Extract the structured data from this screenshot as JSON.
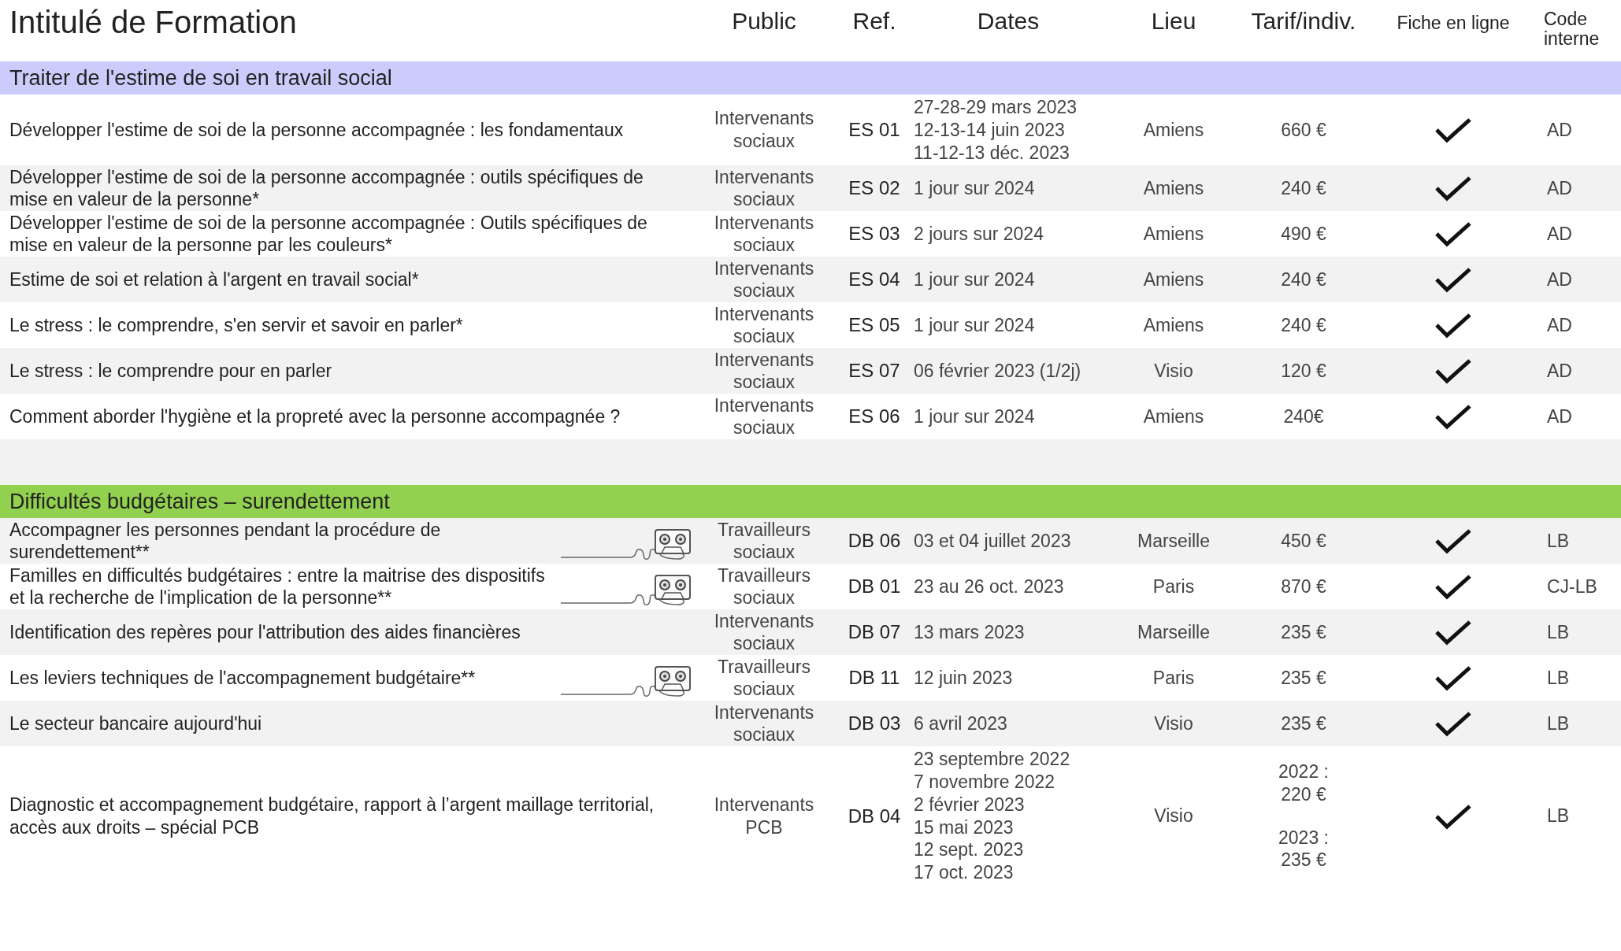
{
  "columns": [
    "Intitulé de Formation",
    "Public",
    "Ref.",
    "Dates",
    "Lieu",
    "Tarif/indiv.",
    "Fiche en ligne",
    "Code interne"
  ],
  "sections": [
    {
      "title": "Traiter de l'estime de soi en travail social",
      "color": "#ccccfc",
      "rows": [
        {
          "title": "Développer l'estime de soi de la personne accompagnée : les fondamentaux",
          "audio": false,
          "public": "Intervenants sociaux",
          "ref": "ES 01",
          "dates": [
            "27-28-29 mars 2023",
            "12-13-14 juin 2023",
            "11-12-13 déc. 2023"
          ],
          "lieu": "Amiens",
          "tarif": [
            "660 €"
          ],
          "online": true,
          "code": "AD",
          "shaded": false
        },
        {
          "title": "Développer l'estime de soi de la personne accompagnée : outils spécifiques de mise en valeur de la personne*",
          "audio": false,
          "public": "Intervenants sociaux",
          "ref": "ES 02",
          "dates": [
            "1 jour sur 2024"
          ],
          "lieu": "Amiens",
          "tarif": [
            "240 €"
          ],
          "online": true,
          "code": "AD",
          "shaded": true
        },
        {
          "title": "Développer l'estime de soi de la personne accompagnée : Outils spécifiques de mise en valeur de la personne par les couleurs*",
          "audio": false,
          "public": "Intervenants sociaux",
          "ref": "ES 03",
          "dates": [
            "2 jours sur 2024"
          ],
          "lieu": "Amiens",
          "tarif": [
            "490 €"
          ],
          "online": true,
          "code": "AD",
          "shaded": false
        },
        {
          "title": "Estime de soi et relation à l'argent en travail social*",
          "audio": false,
          "public": "Intervenants sociaux",
          "ref": "ES 04",
          "dates": [
            "1 jour sur 2024"
          ],
          "lieu": "Amiens",
          "tarif": [
            "240 €"
          ],
          "online": true,
          "code": "AD",
          "shaded": true
        },
        {
          "title": "Le stress : le comprendre, s'en servir et savoir en parler*",
          "audio": false,
          "public": "Intervenants sociaux",
          "ref": "ES 05",
          "dates": [
            "1 jour sur 2024"
          ],
          "lieu": "Amiens",
          "tarif": [
            "240 €"
          ],
          "online": true,
          "code": "AD",
          "shaded": false
        },
        {
          "title": "Le stress : le comprendre pour en parler",
          "audio": false,
          "public": "Intervenants sociaux",
          "ref": "ES 07",
          "dates": [
            "06 février 2023 (1/2j)"
          ],
          "lieu": "Visio",
          "tarif": [
            "120 €"
          ],
          "online": true,
          "code": "AD",
          "shaded": true
        },
        {
          "title": "Comment aborder l'hygiène et la propreté avec la personne accompagnée ?",
          "audio": false,
          "public": "Intervenants sociaux",
          "ref": "ES 06",
          "dates": [
            "1 jour sur 2024"
          ],
          "lieu": "Amiens",
          "tarif": [
            "240€"
          ],
          "online": true,
          "code": "AD",
          "shaded": false
        }
      ]
    },
    {
      "title": "Difficultés budgétaires – surendettement",
      "color": "#92d050",
      "rows": [
        {
          "title": "Accompagner les personnes pendant la procédure de surendettement**",
          "audio": true,
          "public": "Travailleurs sociaux",
          "ref": "DB 06",
          "dates": [
            "03 et 04 juillet 2023"
          ],
          "lieu": "Marseille",
          "tarif": [
            "450 €"
          ],
          "online": true,
          "code": "LB",
          "shaded": true
        },
        {
          "title": "Familles en difficultés budgétaires : entre la maitrise des dispositifs et la recherche de l'implication de la personne**",
          "audio": true,
          "public": "Travailleurs sociaux",
          "ref": "DB 01",
          "dates": [
            "23 au 26 oct. 2023"
          ],
          "lieu": "Paris",
          "tarif": [
            "870 €"
          ],
          "online": true,
          "code": "CJ-LB",
          "shaded": false
        },
        {
          "title": "Identification des repères pour l'attribution des aides financières",
          "audio": false,
          "public": "Intervenants sociaux",
          "ref": "DB 07",
          "dates": [
            "13 mars 2023"
          ],
          "lieu": "Marseille",
          "tarif": [
            "235 €"
          ],
          "online": true,
          "code": "LB",
          "shaded": true
        },
        {
          "title": "Les leviers techniques de l'accompagnement budgétaire**",
          "audio": true,
          "public": "Travailleurs sociaux",
          "ref": "DB 11",
          "dates": [
            "12 juin 2023"
          ],
          "lieu": "Paris",
          "tarif": [
            "235 €"
          ],
          "online": true,
          "code": "LB",
          "shaded": false
        },
        {
          "title": "Le secteur bancaire aujourd'hui",
          "audio": false,
          "public": "Intervenants sociaux",
          "ref": "DB 03",
          "dates": [
            "6 avril 2023"
          ],
          "lieu": "Visio",
          "tarif": [
            "235 €"
          ],
          "online": true,
          "code": "LB",
          "shaded": true
        },
        {
          "title": "Diagnostic et accompagnement budgétaire, rapport à l’argent maillage territorial, accès aux droits – spécial PCB",
          "audio": false,
          "public": "Intervenants PCB",
          "ref": "DB 04",
          "dates": [
            "23 septembre 2022",
            "7 novembre 2022",
            "2 février 2023",
            "15 mai 2023",
            "12 sept. 2023",
            "17 oct. 2023"
          ],
          "lieu": "Visio",
          "tarif": [
            "2022 : 220 €",
            "2023 : 235 €"
          ],
          "online": true,
          "code": "LB",
          "shaded": false
        }
      ]
    }
  ]
}
